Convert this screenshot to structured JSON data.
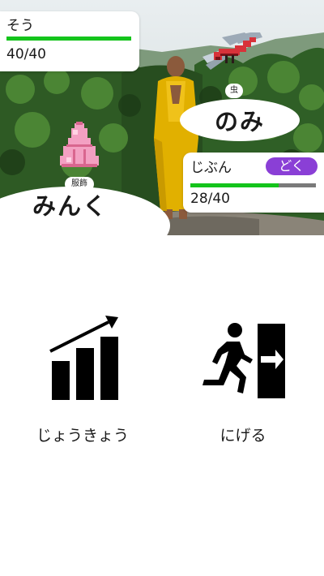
{
  "enemy": {
    "name": "そう",
    "hp_text": "40/40",
    "hp_fraction": 1.0,
    "move_name": "のみ",
    "move_type": "虫",
    "sprite": "dragonfly-sprite"
  },
  "player": {
    "name": "じぶん",
    "status": "どく",
    "hp_text": "28/40",
    "hp_fraction": 0.7,
    "move_name": "みんく",
    "move_type": "服飾",
    "sprite": "dress-sprite"
  },
  "commands": {
    "status_label": "じょうきょう",
    "status_icon": "bar-chart-growth-icon",
    "flee_label": "にげる",
    "flee_icon": "running-exit-icon"
  },
  "colors": {
    "hp_green": "#14c41b",
    "status_purple": "#8a3fd6",
    "hp_track": "#7a7a7a"
  }
}
